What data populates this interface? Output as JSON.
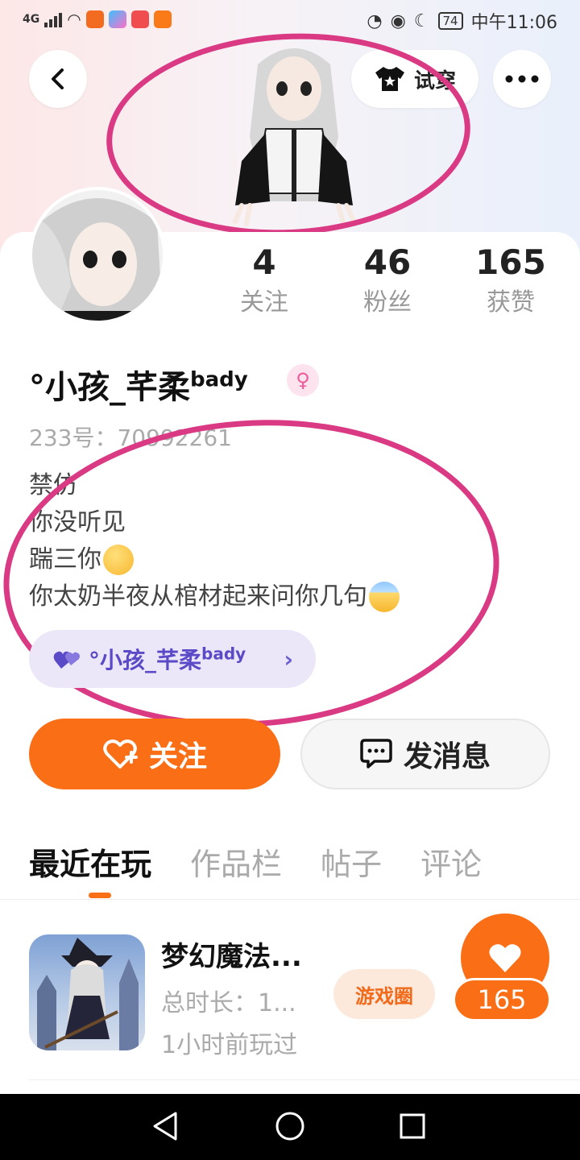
{
  "status_bar": {
    "network": "4G",
    "battery": "74",
    "time": "中午11:06"
  },
  "header": {
    "try_on_label": "试穿"
  },
  "profile": {
    "stats": [
      {
        "value": "4",
        "label": "关注"
      },
      {
        "value": "46",
        "label": "粉丝"
      },
      {
        "value": "165",
        "label": "获赞"
      }
    ],
    "username": "°小孩_芊柔",
    "username_suffix": "bady",
    "gender_icon": "♀",
    "id_text": "233号：70992261",
    "bio_lines": [
      "禁仿",
      "你没听见",
      "踹三你",
      "你太奶半夜从棺材起来问你几句"
    ],
    "cp_name": "°小孩_芊柔",
    "cp_suffix": "bady"
  },
  "actions": {
    "follow_label": "关注",
    "message_label": "发消息"
  },
  "tabs": [
    {
      "label": "最近在玩",
      "active": true
    },
    {
      "label": "作品栏",
      "active": false
    },
    {
      "label": "帖子",
      "active": false
    },
    {
      "label": "评论",
      "active": false
    }
  ],
  "game": {
    "title": "梦幻魔法...",
    "duration": "总时长：1...",
    "last_played": "1小时前玩过",
    "circle_label": "游戏圈",
    "likes": "165"
  },
  "colors": {
    "accent": "#fa6e16",
    "annotation": "#d93a83",
    "chip_bg": "#ebe7f8"
  }
}
